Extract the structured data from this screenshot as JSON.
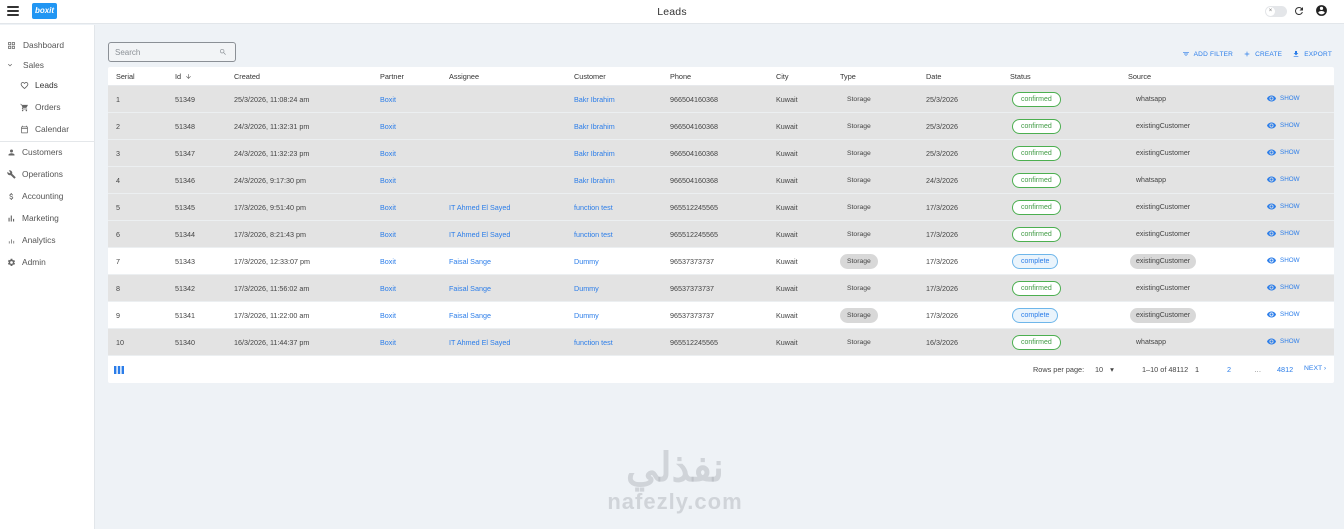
{
  "app": {
    "title": "Leads",
    "logo_text": "boxit",
    "toggle_symbol": "×"
  },
  "sidebar": {
    "items": [
      {
        "label": "Dashboard",
        "icon": "dashboard-icon"
      },
      {
        "label": "Sales",
        "icon": "chevron-down-icon"
      },
      {
        "label": "Leads",
        "icon": "heart-icon"
      },
      {
        "label": "Orders",
        "icon": "cart-icon"
      },
      {
        "label": "Calendar",
        "icon": "calendar-icon"
      },
      {
        "label": "Customers",
        "icon": "person-icon"
      },
      {
        "label": "Operations",
        "icon": "wrench-icon"
      },
      {
        "label": "Accounting",
        "icon": "dollar-icon"
      },
      {
        "label": "Marketing",
        "icon": "bar-chart-icon"
      },
      {
        "label": "Analytics",
        "icon": "analytics-icon"
      },
      {
        "label": "Admin",
        "icon": "gear-icon"
      }
    ]
  },
  "toolbar": {
    "search_placeholder": "Search",
    "add_filter": "ADD FILTER",
    "create": "CREATE",
    "export": "EXPORT"
  },
  "table": {
    "columns": [
      "Serial",
      "Id",
      "Created",
      "Partner",
      "Assignee",
      "Customer",
      "Phone",
      "City",
      "Type",
      "Date",
      "Status",
      "Source"
    ],
    "show_label": "SHOW",
    "rows": [
      {
        "serial": "1",
        "id": "51349",
        "created": "25/3/2026, 11:08:24 am",
        "partner": "Boxit",
        "assignee": "",
        "customer": "Bakr Ibrahim",
        "phone": "966504160368",
        "city": "Kuwait",
        "type": "Storage",
        "date": "25/3/2026",
        "status": "confirmed",
        "source": "whatsapp"
      },
      {
        "serial": "2",
        "id": "51348",
        "created": "24/3/2026, 11:32:31 pm",
        "partner": "Boxit",
        "assignee": "",
        "customer": "Bakr Ibrahim",
        "phone": "966504160368",
        "city": "Kuwait",
        "type": "Storage",
        "date": "25/3/2026",
        "status": "confirmed",
        "source": "existingCustomer"
      },
      {
        "serial": "3",
        "id": "51347",
        "created": "24/3/2026, 11:32:23 pm",
        "partner": "Boxit",
        "assignee": "",
        "customer": "Bakr Ibrahim",
        "phone": "966504160368",
        "city": "Kuwait",
        "type": "Storage",
        "date": "25/3/2026",
        "status": "confirmed",
        "source": "existingCustomer"
      },
      {
        "serial": "4",
        "id": "51346",
        "created": "24/3/2026, 9:17:30 pm",
        "partner": "Boxit",
        "assignee": "",
        "customer": "Bakr Ibrahim",
        "phone": "966504160368",
        "city": "Kuwait",
        "type": "Storage",
        "date": "24/3/2026",
        "status": "confirmed",
        "source": "whatsapp"
      },
      {
        "serial": "5",
        "id": "51345",
        "created": "17/3/2026, 9:51:40 pm",
        "partner": "Boxit",
        "assignee": "IT Ahmed El Sayed",
        "customer": "function test",
        "phone": "965512245565",
        "city": "Kuwait",
        "type": "Storage",
        "date": "17/3/2026",
        "status": "confirmed",
        "source": "existingCustomer"
      },
      {
        "serial": "6",
        "id": "51344",
        "created": "17/3/2026, 8:21:43 pm",
        "partner": "Boxit",
        "assignee": "IT Ahmed El Sayed",
        "customer": "function test",
        "phone": "965512245565",
        "city": "Kuwait",
        "type": "Storage",
        "date": "17/3/2026",
        "status": "confirmed",
        "source": "existingCustomer"
      },
      {
        "serial": "7",
        "id": "51343",
        "created": "17/3/2026, 12:33:07 pm",
        "partner": "Boxit",
        "assignee": "Faisal Sange",
        "customer": "Dummy",
        "phone": "96537373737",
        "city": "Kuwait",
        "type": "Storage",
        "date": "17/3/2026",
        "status": "complete",
        "source": "existingCustomer"
      },
      {
        "serial": "8",
        "id": "51342",
        "created": "17/3/2026, 11:56:02 am",
        "partner": "Boxit",
        "assignee": "Faisal Sange",
        "customer": "Dummy",
        "phone": "96537373737",
        "city": "Kuwait",
        "type": "Storage",
        "date": "17/3/2026",
        "status": "confirmed",
        "source": "existingCustomer"
      },
      {
        "serial": "9",
        "id": "51341",
        "created": "17/3/2026, 11:22:00 am",
        "partner": "Boxit",
        "assignee": "Faisal Sange",
        "customer": "Dummy",
        "phone": "96537373737",
        "city": "Kuwait",
        "type": "Storage",
        "date": "17/3/2026",
        "status": "complete",
        "source": "existingCustomer"
      },
      {
        "serial": "10",
        "id": "51340",
        "created": "16/3/2026, 11:44:37 pm",
        "partner": "Boxit",
        "assignee": "IT Ahmed El Sayed",
        "customer": "function test",
        "phone": "965512245565",
        "city": "Kuwait",
        "type": "Storage",
        "date": "16/3/2026",
        "status": "confirmed",
        "source": "whatsapp"
      }
    ]
  },
  "pagination": {
    "rows_per_page_label": "Rows per page:",
    "rows_per_page": "10",
    "range": "1–10 of 48112",
    "pages": [
      "1",
      "2",
      "…",
      "4812"
    ],
    "next": "NEXT ›"
  },
  "watermark": {
    "arabic": "نفذلي",
    "latin": "nafezly.com"
  },
  "colors": {
    "accent": "#2b7de9",
    "confirmed": "#4caf50",
    "row_gray": "#e3e3e3"
  }
}
